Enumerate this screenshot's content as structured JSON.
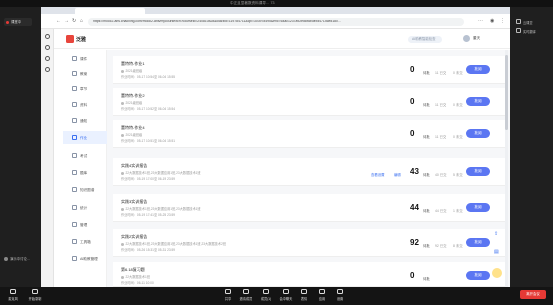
{
  "meeting": {
    "title": "中正且显著数资料课导… 73",
    "recording_label": "课堂中",
    "share_status": "演示中讨论...",
    "toolbar": [
      {
        "label": "麦克风",
        "icon": "mic-icon"
      },
      {
        "label": "开始录制",
        "icon": "record-icon"
      },
      {
        "label": "共享",
        "icon": "share-icon"
      },
      {
        "label": "邀请成员",
        "icon": "invite-icon"
      },
      {
        "label": "成员(1)",
        "icon": "members-icon"
      },
      {
        "label": "会中聊天",
        "icon": "chat-icon"
      },
      {
        "label": "表情",
        "icon": "emoji-icon"
      },
      {
        "label": "应用",
        "icon": "apps-icon"
      },
      {
        "label": "设置",
        "icon": "settings-icon"
      }
    ],
    "leave_label": "离开会议",
    "right_rail": [
      {
        "label": "云课堂",
        "icon": "cloud-icon"
      },
      {
        "label": "实时翻译",
        "icon": "translate-icon"
      }
    ]
  },
  "browser": {
    "url": "https://mooc2-ans.chaoxing.com/mooc2-ans/mycourse/tch?courseid=240810828&clazzid=119784711&cpi=303978495&enc=64ac1237a92ed8fd49a9d47146ed180..."
  },
  "header": {
    "logo_text": "泛雅",
    "pill_text": "AI助教智能检查",
    "user_name": "董天"
  },
  "course_nav": [
    {
      "label": "课件"
    },
    {
      "label": "教案"
    },
    {
      "label": "章节"
    },
    {
      "label": "资料"
    },
    {
      "label": "通知"
    },
    {
      "label": "作业"
    },
    {
      "label": "考试"
    },
    {
      "label": "题库"
    },
    {
      "label": "知识图谱"
    },
    {
      "label": "统计"
    },
    {
      "label": "管理"
    },
    {
      "label": "工具箱"
    },
    {
      "label": "AI助教管理"
    }
  ],
  "active_nav": "作业",
  "assignments": [
    {
      "title": "董特特-作业1",
      "meta": "2021级班级",
      "time": "作业时间：05-17 10:54至 06-04 15:55",
      "count": "0",
      "unit": "待批",
      "sub1": "11 已交",
      "sub2": "0 未交",
      "button": "批阅",
      "links": []
    },
    {
      "title": "董特特-作业2",
      "meta": "2021级班级",
      "time": "作业时间：05-17 10:52至 06-04 15:54",
      "count": "0",
      "unit": "待批",
      "sub1": "11 已交",
      "sub2": "0 未交",
      "button": "批阅",
      "links": []
    },
    {
      "title": "董特特-作业4",
      "meta": "2021级班级",
      "time": "作业时间：05-17 10:51至 06-04 15:51",
      "count": "0",
      "unit": "待批",
      "sub1": "11 已交",
      "sub2": "0 未交",
      "button": "批阅",
      "links": []
    },
    {
      "title": "实践4实训报告",
      "meta": "22大数据技术1班,23大数据应用1班,23大数据技术1班",
      "time": "作业时间：05-19 17:00至 06-19 23:59",
      "count": "43",
      "unit": "待批",
      "sub1": "40 已交",
      "sub2": "5 未交",
      "button": "批阅",
      "links": [
        "查看设置",
        "编辑"
      ]
    },
    {
      "title": "实践3实训报告",
      "meta": "22大数据技术1班,23大数据应用1班,23大数据技术1班",
      "time": "作业时间：05-19 17:41至 05-25 23:59",
      "count": "44",
      "unit": "待批",
      "sub1": "44 已交",
      "sub2": "1 未交",
      "button": "批阅",
      "links": []
    },
    {
      "title": "实践2实训报告",
      "meta": "22大数据技术1班,23大数据应用1班,23大数据技术1班,23大数据技术2班",
      "time": "作业时间：05-26 15:31至 05-31 23:59",
      "count": "92",
      "unit": "待批",
      "sub1": "92 已交",
      "sub2": "8 未交",
      "button": "批阅",
      "links": []
    },
    {
      "title": "第6.18复习题",
      "meta": "22大数据技术1班",
      "time": "作业时间：06-11 10:00",
      "count": "0",
      "unit": "待批",
      "sub1": "",
      "sub2": "",
      "button": "批阅",
      "links": []
    }
  ]
}
